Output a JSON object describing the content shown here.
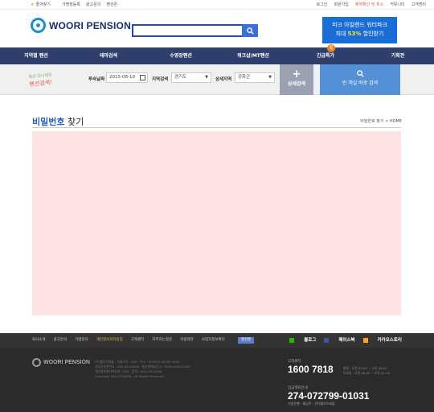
{
  "util_bar": {
    "left": [
      "즐겨찾기",
      "가맹점등록",
      "광고문의",
      "펜션존"
    ],
    "right": [
      "로그인",
      "회원가입",
      "예약확인 및 취소",
      "커뮤니티",
      "고객센터"
    ]
  },
  "header": {
    "logo": "WOORI PENSION",
    "search_placeholder": "",
    "banner_line1": "피크 아일랜드 워터파크",
    "banner_line2_prefix": "최대 ",
    "banner_line2_highlight": "53%",
    "banner_line2_suffix": " 할인받기"
  },
  "nav": {
    "items": [
      "지역별 펜션",
      "테마검색",
      "수영장펜션",
      "워크샵/MT펜션",
      "긴급특가",
      "기획전"
    ],
    "badge": "특"
  },
  "filter": {
    "slogan_top": "학교 다니세요",
    "slogan_main": "펜션검색!",
    "date_label": "투숙날짜",
    "date_value": "2015-08-10",
    "region_label": "지역검색",
    "region_value": "경기도",
    "subregion_label": "상세지역",
    "subregion_value": "강화군",
    "detail_button": "상세검색",
    "empty_button": "빈 객실 바로 검색"
  },
  "content": {
    "title_highlight": "비밀번호",
    "title_rest": " 찾기",
    "breadcrumb": "비밀번호 찾기 < HOME"
  },
  "footer_nav": {
    "links": [
      "회사소개",
      "광고문의",
      "가맹문의",
      "개인정보처리방침",
      "고객센터",
      "자주하는질문",
      "이용약관",
      "사업자정보확인"
    ],
    "active_index": 3,
    "tag": "펜션존",
    "sns": [
      "블로그",
      "페이스북",
      "카카오스토리"
    ]
  },
  "footer": {
    "logo": "WOORI PENSION",
    "info_lines": [
      "(주)헬로트래블 · 대표이사 : 000 · 주소 : 000000 00000 0000",
      "사업자등록번호 : 000-00-00000 · 통신판매업신고 : 0000-0000-0000",
      "개인정보관리책임자 : 000 · 문의 : 000-000-0000",
      "Copyright HELLOTRAVEL. All Rights Reserved."
    ],
    "cs_label": "고객센터",
    "cs_number": "1600 7818",
    "cs_hours": [
      "평일 : 오전 09:00 ~ 오후 06:00",
      "토요일 : 오전 09:00 ~ 오후 01:00"
    ],
    "account_label": "입금계좌안내",
    "account_number": "274-072799-01031",
    "account_holder": "기업은행 · 예금주 : (주)헬로트래블"
  },
  "colors": {
    "nav_bg": "#2f3e6a",
    "accent_blue": "#2a5bb5",
    "content_bg": "#fde3e3",
    "footer_bg": "#2b2b2b"
  }
}
